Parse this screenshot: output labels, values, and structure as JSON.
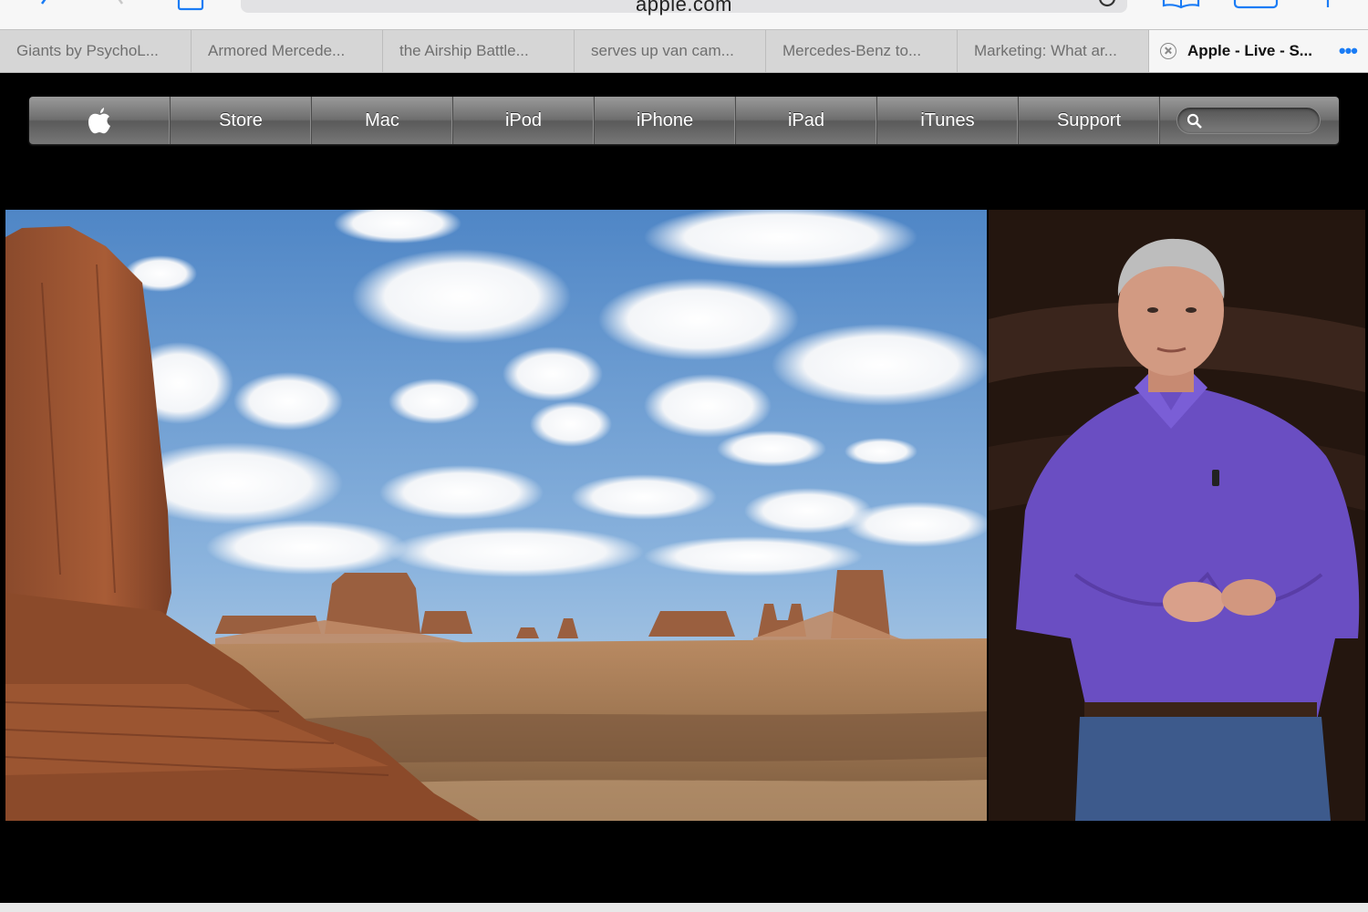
{
  "browser": {
    "address": "apple.com",
    "tint_color": "#1a7cf5",
    "tabs": [
      {
        "title": "Giants by PsychoL..."
      },
      {
        "title": "Armored Mercede..."
      },
      {
        "title": "the Airship Battle..."
      },
      {
        "title": "serves up van cam..."
      },
      {
        "title": "Mercedes-Benz to..."
      },
      {
        "title": "Marketing: What ar..."
      }
    ],
    "active_tab": {
      "title": "Apple - Live - S..."
    }
  },
  "globalnav": {
    "logo_icon": "apple-logo-icon",
    "items": [
      {
        "label": "Store"
      },
      {
        "label": "Mac"
      },
      {
        "label": "iPod"
      },
      {
        "label": "iPhone"
      },
      {
        "label": "iPad"
      },
      {
        "label": "iTunes"
      },
      {
        "label": "Support"
      }
    ],
    "search_icon": "search-icon"
  },
  "video": {
    "left_panel": "desert landscape slide",
    "right_panel": "presenter on stage"
  }
}
